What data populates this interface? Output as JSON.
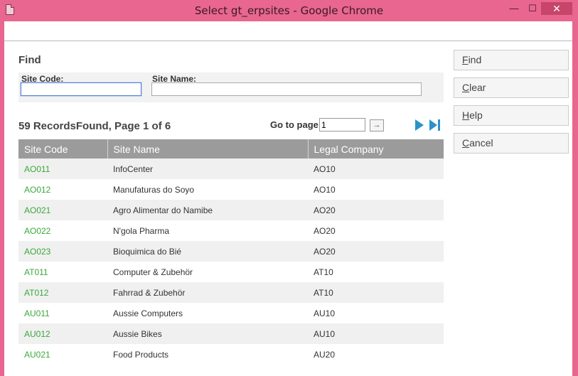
{
  "window": {
    "title": "Select gt_erpsites - Google Chrome",
    "min_glyph": "—",
    "max_glyph": "☐",
    "close_glyph": "✕"
  },
  "find": {
    "heading": "Find",
    "site_code_label": "Site Code:",
    "site_code_value": "",
    "site_name_label": "Site Name:",
    "site_name_value": ""
  },
  "pager": {
    "records_text": "59 RecordsFound, Page 1 of 6",
    "goto_label": "Go to page",
    "goto_value": "1",
    "goto_button_glyph": "→"
  },
  "table": {
    "columns": [
      "Site Code",
      "Site Name",
      "Legal Company"
    ],
    "rows": [
      {
        "code": "AO011",
        "name": "InfoCenter",
        "company": "AO10"
      },
      {
        "code": "AO012",
        "name": "Manufaturas do Soyo",
        "company": "AO10"
      },
      {
        "code": "AO021",
        "name": "Agro Alimentar do Namibe",
        "company": "AO20"
      },
      {
        "code": "AO022",
        "name": "N'gola Pharma",
        "company": "AO20"
      },
      {
        "code": "AO023",
        "name": "Bioquimica do Bié",
        "company": "AO20"
      },
      {
        "code": "AT011",
        "name": "Computer & Zubehör",
        "company": "AT10"
      },
      {
        "code": "AT012",
        "name": "Fahrrad & Zubehör",
        "company": "AT10"
      },
      {
        "code": "AU011",
        "name": "Aussie Computers",
        "company": "AU10"
      },
      {
        "code": "AU012",
        "name": "Aussie Bikes",
        "company": "AU10"
      },
      {
        "code": "AU021",
        "name": "Food Products",
        "company": "AU20"
      }
    ]
  },
  "buttons": {
    "find": {
      "accel": "F",
      "rest": "ind"
    },
    "clear": {
      "accel": "C",
      "rest": "lear"
    },
    "help": {
      "accel": "H",
      "rest": "elp"
    },
    "cancel": {
      "accel": "C",
      "rest": "ancel"
    }
  },
  "colors": {
    "titlebar": "#e8668f",
    "header_bg": "#9b9b9b",
    "site_code_link": "#3aa83a",
    "nav_arrow": "#2a93c9"
  },
  "icons": {
    "next_page": "next-page-icon",
    "last_page": "last-page-icon",
    "goto": "arrow-right-icon",
    "page": "page-icon"
  }
}
